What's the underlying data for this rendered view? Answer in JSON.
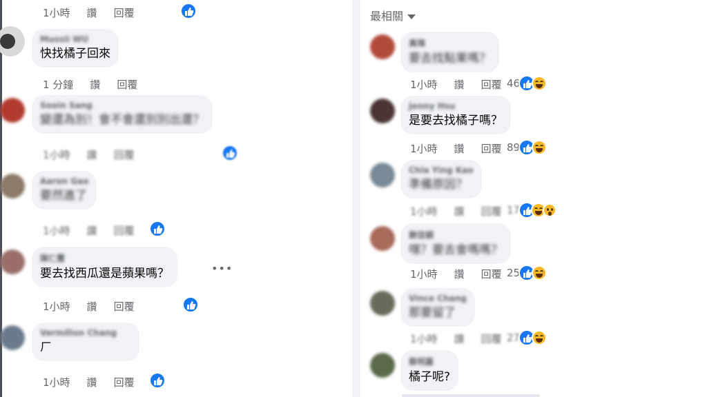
{
  "left_panel": {
    "top_row": {
      "time": "1小時",
      "like": "讚",
      "reply": "回覆"
    },
    "comments": [
      {
        "author": "Mussii WU",
        "text": "快找橘子回來",
        "time": "1 分鐘",
        "like": "讚",
        "reply": "回覆",
        "blurred_text": false,
        "avatar_color": "#3a3a3a"
      },
      {
        "author": "Sooin Sang",
        "text": "變還為別！會不會還別別出還？",
        "time": "1小時",
        "like": "讚",
        "reply": "回覆",
        "blurred_text": true,
        "avatar_color": "#b23b2e"
      },
      {
        "author": "Aaron Gao",
        "text": "要然進了",
        "time": "1小時",
        "like": "讚",
        "reply": "回覆",
        "blurred_text": true,
        "avatar_color": "#8c7a6a"
      },
      {
        "author": "陳仁豐",
        "text": "要去找西瓜還是蘋果嗎？",
        "time": "1小時",
        "like": "讚",
        "reply": "回覆",
        "blurred_text": false,
        "avatar_color": "#9a6d6a"
      },
      {
        "author": "Vermilion Chang",
        "text": "ㄏ",
        "time": "1小時",
        "like": "讚",
        "reply": "回覆",
        "blurred_text": false,
        "avatar_color": "#6b7a8c"
      }
    ]
  },
  "right_panel": {
    "sort_label": "最相關",
    "comments": [
      {
        "author": "黃瑋",
        "text": "要去找點果嗎？",
        "time": "1小時",
        "like": "讚",
        "reply": "回覆",
        "count": "46",
        "blurred_text": true,
        "avatar_color": "#b24a3a"
      },
      {
        "author": "Jenny Hsu",
        "text": "是要去找橘子嗎？",
        "time": "1小時",
        "like": "讚",
        "reply": "回覆",
        "count": "89",
        "blurred_text": false,
        "avatar_color": "#4a3434"
      },
      {
        "author": "Chia Ying Kao",
        "text": "準備原因？",
        "time": "1小時",
        "like": "讚",
        "reply": "回覆",
        "count": "17",
        "blurred_text": true,
        "avatar_color": "#7a8a96"
      },
      {
        "author": "謝佳穎",
        "text": "嘿？要去會嗎嗎？",
        "time": "1小時",
        "like": "讚",
        "reply": "回覆",
        "count": "25",
        "blurred_text": true,
        "avatar_color": "#a86a5a"
      },
      {
        "author": "Vince Chang",
        "text": "那要留了",
        "time": "1小時",
        "like": "讚",
        "reply": "回覆",
        "count": "27",
        "blurred_text": true,
        "avatar_color": "#6a6a5a"
      },
      {
        "author": "蔡明嘉",
        "text": "橘子呢?",
        "time": "",
        "like": "",
        "reply": "",
        "count": "",
        "blurred_text": false,
        "avatar_color": "#5c6a4a"
      }
    ]
  },
  "colors": {
    "accent": "#1877f2",
    "haha": "#f7b928",
    "bubble": "#f0f2f5",
    "meta": "#65676b"
  },
  "icons": {
    "like": "like-thumb-icon",
    "haha": "haha-emoji-icon",
    "wow": "wow-emoji-icon",
    "more": "more-dots-icon",
    "caret": "chevron-down-icon"
  }
}
